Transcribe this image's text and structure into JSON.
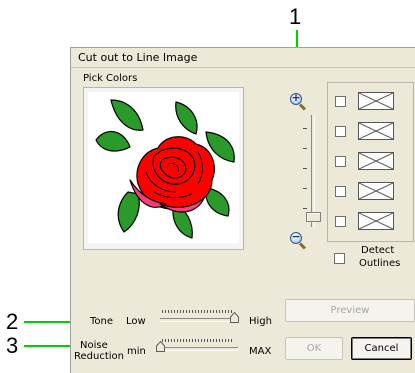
{
  "callouts": {
    "one": "1",
    "two": "2",
    "three": "3"
  },
  "window": {
    "title": "Cut out to Line Image"
  },
  "pick_colors": {
    "label": "Pick Colors"
  },
  "colors": {
    "rows": [
      {
        "checked": false
      },
      {
        "checked": false
      },
      {
        "checked": false
      },
      {
        "checked": false
      },
      {
        "checked": false
      }
    ],
    "detect_outlines": {
      "line1": "Detect",
      "line2": "Outlines",
      "checked": false
    }
  },
  "preview_button": {
    "label": "Preview",
    "enabled": false
  },
  "tone": {
    "label": "Tone",
    "min_label": "Low",
    "max_label": "High",
    "value_fraction": 1.0
  },
  "noise": {
    "label_line1": "Noise",
    "label_line2": "Reduction",
    "min_label": "min",
    "max_label": "MAX",
    "value_fraction": 0.0
  },
  "ok_button": {
    "label": "OK",
    "enabled": false
  },
  "cancel_button": {
    "label": "Cancel"
  },
  "colors_palette": {
    "accent_callout": "#00d000",
    "dialog_bg": "#ece9d8",
    "rose_red": "#ff0000",
    "leaf_green": "#2a9a2a"
  }
}
